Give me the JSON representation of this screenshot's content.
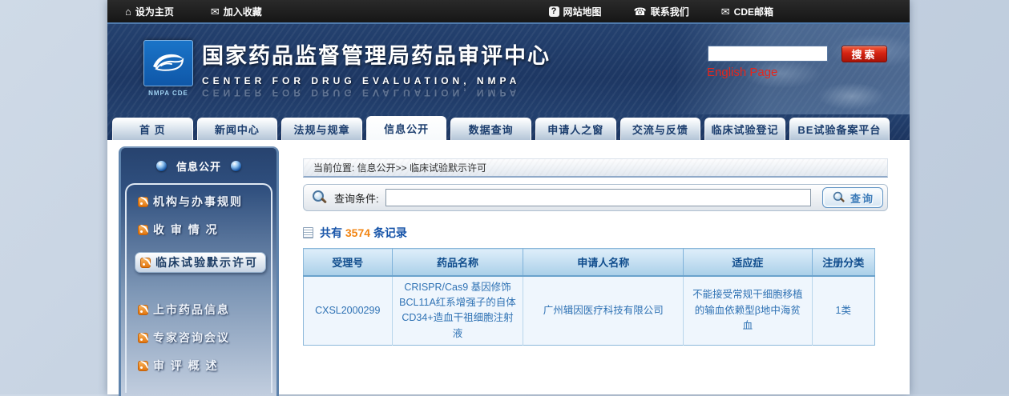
{
  "topbar": {
    "links_left": [
      {
        "icon": "home-icon",
        "label": "设为主页"
      },
      {
        "icon": "mail-icon",
        "label": "加入收藏"
      }
    ],
    "links_right": [
      {
        "icon": "question-icon",
        "label": "网站地图"
      },
      {
        "icon": "phone-icon",
        "label": "联系我们"
      },
      {
        "icon": "mail-icon",
        "label": "CDE邮箱"
      }
    ]
  },
  "header": {
    "logo_caption": "NMPA CDE",
    "title": "国家药品监督管理局药品审评中心",
    "subtitle": "CENTER FOR DRUG EVALUATION, NMPA",
    "search_value": "",
    "search_button": "搜索",
    "english_link": "English Page"
  },
  "nav": {
    "tabs": [
      {
        "label": "首 页",
        "active": false
      },
      {
        "label": "新闻中心",
        "active": false
      },
      {
        "label": "法规与规章",
        "active": false
      },
      {
        "label": "信息公开",
        "active": true
      },
      {
        "label": "数据查询",
        "active": false
      },
      {
        "label": "申请人之窗",
        "active": false
      },
      {
        "label": "交流与反馈",
        "active": false
      },
      {
        "label": "临床试验登记",
        "active": false
      },
      {
        "label": "BE试验备案平台",
        "active": false
      }
    ]
  },
  "sidebar": {
    "title": "信息公开",
    "items": [
      {
        "label": "机构与办事规则",
        "active": false
      },
      {
        "label": "收 审 情 况",
        "active": false
      },
      {
        "label": "临床试验默示许可",
        "active": true
      },
      {
        "label": "上市药品信息",
        "active": false
      },
      {
        "label": "专家咨询会议",
        "active": false
      },
      {
        "label": "审 评 概 述",
        "active": false
      }
    ]
  },
  "main": {
    "breadcrumb": "当前位置: 信息公开>> 临床试验默示许可",
    "search": {
      "label": "查询条件:",
      "value": "",
      "button": "查询"
    },
    "count": {
      "prefix": "共有",
      "number": "3574",
      "suffix": "条记录"
    },
    "table": {
      "columns": [
        "受理号",
        "药品名称",
        "申请人名称",
        "适应症",
        "注册分类"
      ],
      "rows": [
        [
          "CXSL2000299",
          "CRISPR/Cas9 基因修饰BCL11A红系增强子的自体CD34+造血干祖细胞注射液",
          "广州辑因医疗科技有限公司",
          "不能接受常规干细胞移植的输血依赖型β地中海贫血",
          "1类"
        ]
      ]
    }
  },
  "colors": {
    "header_navy": "#203a66",
    "accent_red": "#d42312",
    "count_orange": "#f28411",
    "link_blue": "#1553a8",
    "table_header_text": "#0f4c8c",
    "table_text_blue": "#2f72b4"
  }
}
